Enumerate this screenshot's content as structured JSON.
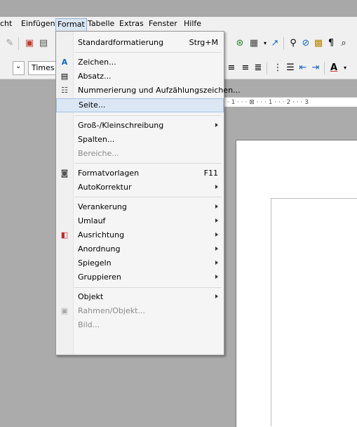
{
  "menubar": {
    "items": [
      "cht",
      "Einfügen",
      "Format",
      "Tabelle",
      "Extras",
      "Fenster",
      "Hilfe"
    ]
  },
  "toolbar": {
    "font_name": "Times",
    "ruler_text": "· · 1 · · · ⊠ · · · 1 · · · 2 · · · 3"
  },
  "format_menu": {
    "items": [
      {
        "label": "Standardformatierung",
        "shortcut": "Strg+M"
      },
      {
        "label": "Zeichen...",
        "icon": "character-icon"
      },
      {
        "label": "Absatz...",
        "icon": "paragraph-icon"
      },
      {
        "label": "Nummerierung und Aufzählungszeichen...",
        "icon": "numbering-icon"
      },
      {
        "label": "Seite...",
        "highlighted": true
      },
      {
        "label": "Groß-/Kleinschreibung",
        "submenu": true
      },
      {
        "label": "Spalten..."
      },
      {
        "label": "Bereiche...",
        "disabled": true
      },
      {
        "label": "Formatvorlagen",
        "shortcut": "F11",
        "icon": "styles-icon"
      },
      {
        "label": "AutoKorrektur",
        "submenu": true
      },
      {
        "label": "Verankerung",
        "submenu": true
      },
      {
        "label": "Umlauf",
        "submenu": true
      },
      {
        "label": "Ausrichtung",
        "submenu": true,
        "icon": "alignment-icon"
      },
      {
        "label": "Anordnung",
        "submenu": true
      },
      {
        "label": "Spiegeln",
        "submenu": true
      },
      {
        "label": "Gruppieren",
        "submenu": true
      },
      {
        "label": "Objekt",
        "submenu": true
      },
      {
        "label": "Rahmen/Objekt...",
        "disabled": true,
        "icon": "frame-icon"
      },
      {
        "label": "Bild...",
        "disabled": true
      }
    ]
  }
}
